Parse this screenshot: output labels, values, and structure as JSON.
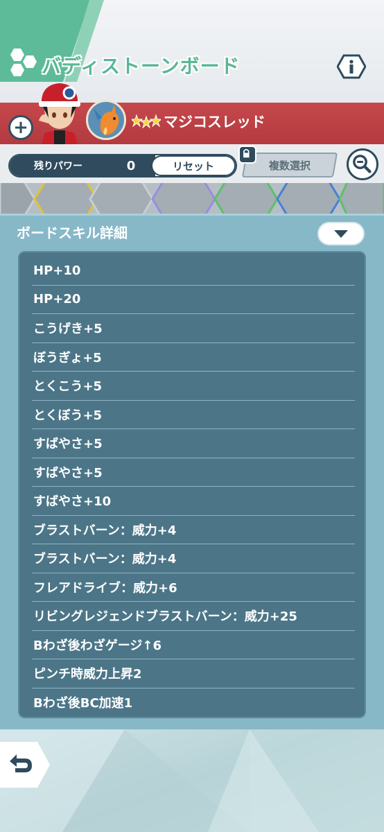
{
  "header": {
    "title": "バディストーンボード"
  },
  "pair": {
    "name": "マジコスレッド",
    "stars": 3
  },
  "power": {
    "label": "残りパワー",
    "value": "0",
    "reset_label": "リセット",
    "multi_select_label": "複数選択"
  },
  "panel": {
    "title": "ボードスキル詳細",
    "skills": [
      "HP+10",
      "HP+20",
      "こうげき+5",
      "ぼうぎょ+5",
      "とくこう+5",
      "とくぼう+5",
      "すばやさ+5",
      "すばやさ+5",
      "すばやさ+10",
      "ブラストバーン：威力+4",
      "ブラストバーン：威力+4",
      "フレアドライブ：威力+6",
      "リビングレジェンドブラストバーン：威力+25",
      "Bわざ後わざゲージ↑6",
      "ピンチ時威力上昇2",
      "Bわざ後BC加速1"
    ]
  },
  "colors": {
    "title_green": "#5ab795",
    "red_band": "#b33a3f",
    "panel_bg": "#87b8c8",
    "list_bg": "#4c7688",
    "navy": "#2f4b5d"
  }
}
